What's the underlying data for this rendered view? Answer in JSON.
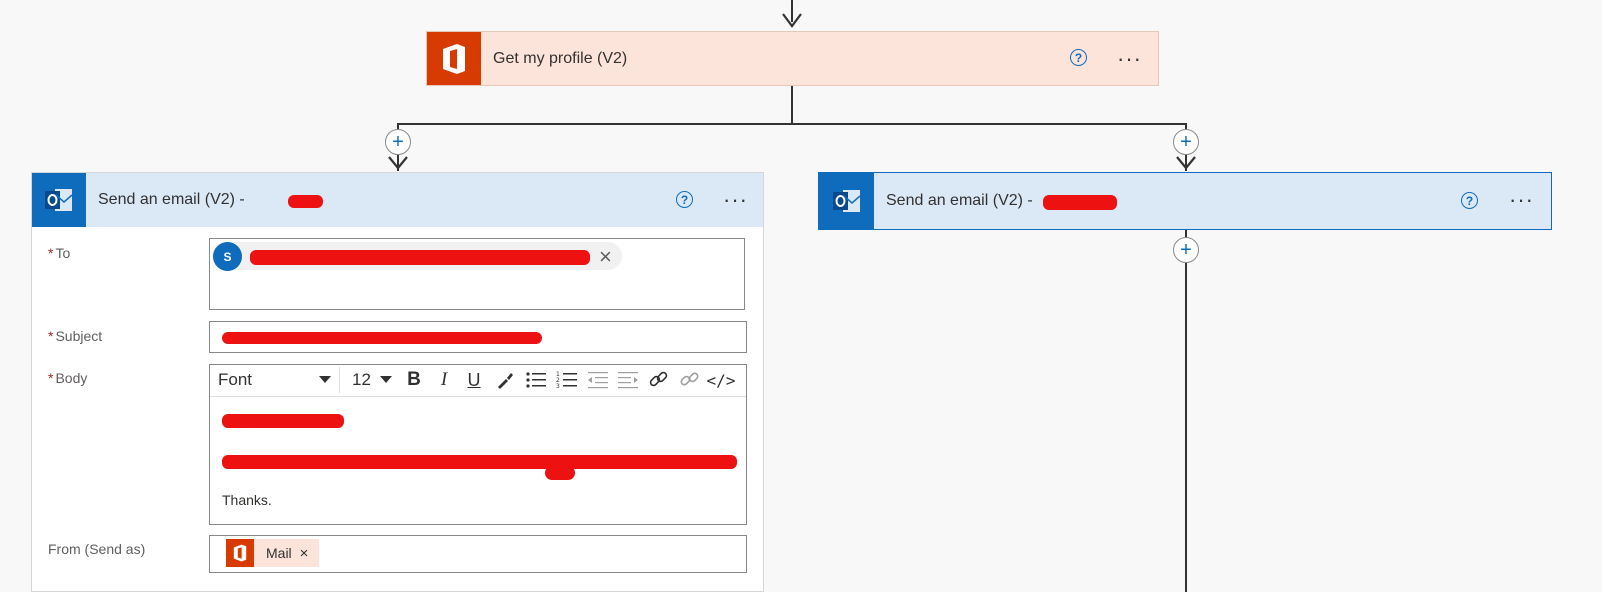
{
  "flow": {
    "profile_step": {
      "title": "Get my profile (V2)",
      "help": "?",
      "more": "···"
    },
    "email_left": {
      "title": "Send an email (V2) -",
      "help": "?",
      "more": "···",
      "to_label": "To",
      "to_chip_initial": "S",
      "subject_label": "Subject",
      "body_label": "Body",
      "font_name": "Font",
      "font_size": "12",
      "body_text_thanks": "Thanks.",
      "from_label": "From (Send as)",
      "from_chip_label": "Mail"
    },
    "email_right": {
      "title": "Send an email (V2) -",
      "help": "?",
      "more": "···"
    },
    "add_icon": "+",
    "remove_icon": "×"
  },
  "colors": {
    "office_orange": "#d83b01",
    "outlook_blue": "#0f6cbd",
    "profile_header_bg": "#fde4da",
    "email_header_bg": "#dbe8f6",
    "redaction": "#ee1111"
  },
  "icons": [
    "arrow-down-icon",
    "office-icon",
    "outlook-icon",
    "help-icon",
    "more-icon",
    "plus-icon",
    "close-icon",
    "bold-icon",
    "italic-icon",
    "underline-icon",
    "paint-icon",
    "bullet-list-icon",
    "number-list-icon",
    "outdent-icon",
    "indent-icon",
    "link-icon",
    "unlink-icon",
    "code-view-icon"
  ]
}
